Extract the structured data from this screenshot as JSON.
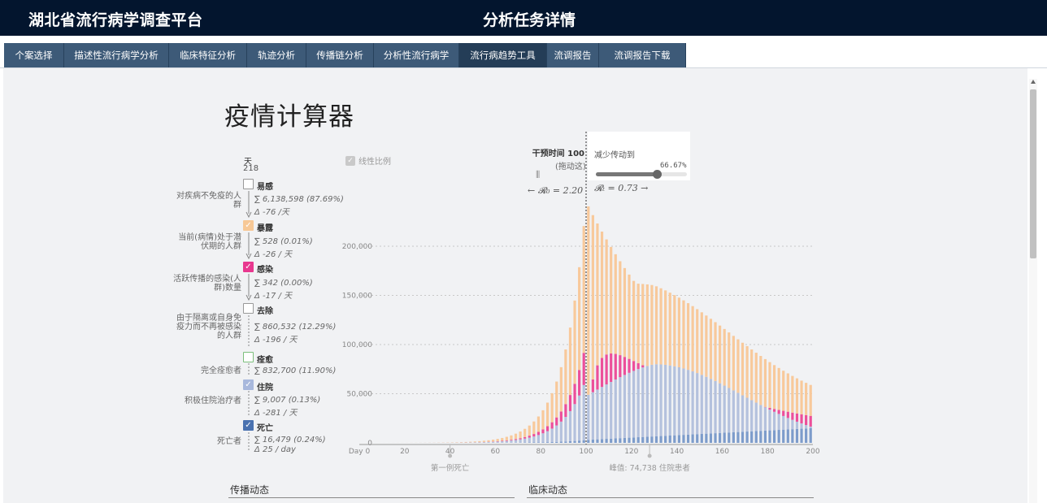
{
  "header": {
    "platform_title": "湖北省流行病学调查平台",
    "page_title": "分析任务详情"
  },
  "tabs": [
    {
      "label": "个案选择"
    },
    {
      "label": "描述性流行病学分析"
    },
    {
      "label": "临床特征分析"
    },
    {
      "label": "轨迹分析"
    },
    {
      "label": "传播链分析"
    },
    {
      "label": "分析性流行病学"
    },
    {
      "label": "流行病趋势工具",
      "active": true
    },
    {
      "label": "流调报告"
    },
    {
      "label": "流调报告下载"
    }
  ],
  "calculator": {
    "title": "疫情计算器",
    "day_label": "天",
    "day_value": "218",
    "linear_scale_label": "线性比例",
    "intervention_label": "干预时间 100",
    "drag_hint": "(拖动这)",
    "r0_text": "← 𝓡₀ = 2.20",
    "popup_label": "减少传动到",
    "slider_value_text": "66.67%",
    "slider_fraction": 0.6667,
    "rt_text": "𝓡ₜ = 0.73 →",
    "compartments": [
      {
        "label": "易感",
        "desc": "对疾病不免疫的人群",
        "sum": "∑ 6,138,598 (87.69%)",
        "delta": "Δ -76 /天",
        "checked": false,
        "color": "#999999"
      },
      {
        "label": "暴露",
        "desc": "当前(病情)处于潜伏期的人群",
        "sum": "∑ 528 (0.01%)",
        "delta": "Δ -26 / 天",
        "checked": true,
        "color": "#f7c896"
      },
      {
        "label": "感染",
        "desc": "活跃传播的感染(人群)数量",
        "sum": "∑ 342 (0.00%)",
        "delta": "Δ -17 / 天",
        "checked": true,
        "color": "#e8388f"
      },
      {
        "label": "去除",
        "desc": "由于隔离或自身免疫力而不再被感染的人群",
        "sum": "∑ 860,532 (12.29%)",
        "delta": "Δ -196 / 天",
        "checked": false,
        "color": "#777777"
      },
      {
        "label": "痊愈",
        "desc": "完全痊愈者",
        "sum": "∑ 832,700 (11.90%)",
        "delta": "",
        "checked": false,
        "color": "#7cbf7c"
      },
      {
        "label": "住院",
        "desc": "积极住院治疗者",
        "sum": "∑ 9,007 (0.13%)",
        "delta": "Δ -281 / 天",
        "checked": true,
        "color": "#a8b8dc"
      },
      {
        "label": "死亡",
        "desc": "死亡者",
        "sum": "∑ 16,479 (0.24%)",
        "delta": "Δ 25 / day",
        "checked": true,
        "color": "#4a72b0"
      }
    ]
  },
  "chart_data": {
    "type": "bar",
    "stacked": true,
    "x_range": [
      0,
      200
    ],
    "y_range": [
      0,
      260000
    ],
    "yticks": [
      "0",
      "50,000",
      "100,000",
      "150,000",
      "200,000"
    ],
    "ytick_values": [
      0,
      50000,
      100000,
      150000,
      200000
    ],
    "xticks": [
      "Day 0",
      "20",
      "40",
      "60",
      "80",
      "100",
      "120",
      "140",
      "160",
      "180",
      "200"
    ],
    "xtick_values": [
      0,
      20,
      40,
      60,
      80,
      100,
      120,
      140,
      160,
      180,
      200
    ],
    "intervention_day": 100,
    "annotations": [
      {
        "day": 40,
        "text": "第一例死亡"
      },
      {
        "day": 128,
        "text": "峰值: 74,738 住院患者"
      }
    ],
    "series_colors": {
      "death": "#7d9ccb",
      "hospitalized": "#b4c1dd",
      "infected": "#ec4f9a",
      "exposed": "#f8c99b"
    },
    "series": [
      {
        "key": "death",
        "peak": 15000
      },
      {
        "key": "hospitalized",
        "peak": 80000
      },
      {
        "key": "infected",
        "peak": 113000
      },
      {
        "key": "exposed",
        "peak": 245000
      }
    ]
  },
  "sections": {
    "transmission": "传播动态",
    "clinical": "临床动态"
  }
}
